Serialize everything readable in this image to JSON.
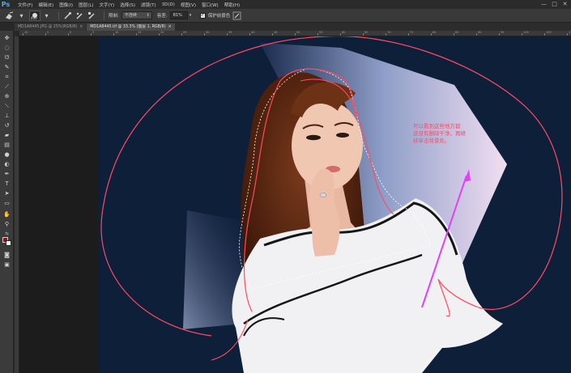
{
  "app": {
    "logo": "Ps",
    "menu": [
      "文件(F)",
      "编辑(E)",
      "图像(I)",
      "图层(L)",
      "文字(Y)",
      "选择(S)",
      "滤镜(T)",
      "3D(D)",
      "视图(V)",
      "窗口(W)",
      "帮助(H)"
    ],
    "window_controls": [
      "—",
      "□",
      "✕"
    ]
  },
  "options": {
    "brush_size": "400",
    "limits_label": "限制:",
    "limits_value": "不连续",
    "tolerance_label": "容差:",
    "tolerance_value": "81%",
    "protect_fg_label": "保护前景色"
  },
  "tabs": [
    {
      "label": "MD1A8445.JPG @ 25%(RGB/8)",
      "close": "×"
    },
    {
      "label": "MD1A8445.tif @ 33.3% (图层 1, RGB/8)",
      "close": "×"
    }
  ],
  "ruler_ticks": [
    "10",
    "5",
    "0",
    "5",
    "10",
    "15",
    "20",
    "25",
    "30",
    "35",
    "40",
    "45",
    "50",
    "55",
    "60",
    "65",
    "70",
    "75",
    "80",
    "85",
    "90",
    "95",
    "100",
    "105",
    "110"
  ],
  "annotation": {
    "lines": [
      "可以看到这些地方都",
      "还没有删除干净，再继",
      "续单击背景处。"
    ]
  },
  "colors": {
    "canvas_bg": "#0e1f3a",
    "annotation_red": "#ff4a60",
    "arrow_magenta": "#e040ff",
    "foreground_swatch": "#7a1f1f",
    "background_swatch": "#ffffff"
  },
  "tools": [
    "move-tool-icon",
    "marquee-tool-icon",
    "lasso-tool-icon",
    "quick-select-tool-icon",
    "crop-tool-icon",
    "eyedropper-tool-icon",
    "healing-tool-icon",
    "brush-tool-icon",
    "clone-stamp-tool-icon",
    "history-brush-tool-icon",
    "eraser-tool-icon",
    "gradient-tool-icon",
    "blur-tool-icon",
    "dodge-tool-icon",
    "pen-tool-icon",
    "type-tool-icon",
    "path-select-tool-icon",
    "shape-tool-icon",
    "hand-tool-icon",
    "zoom-tool-icon"
  ]
}
